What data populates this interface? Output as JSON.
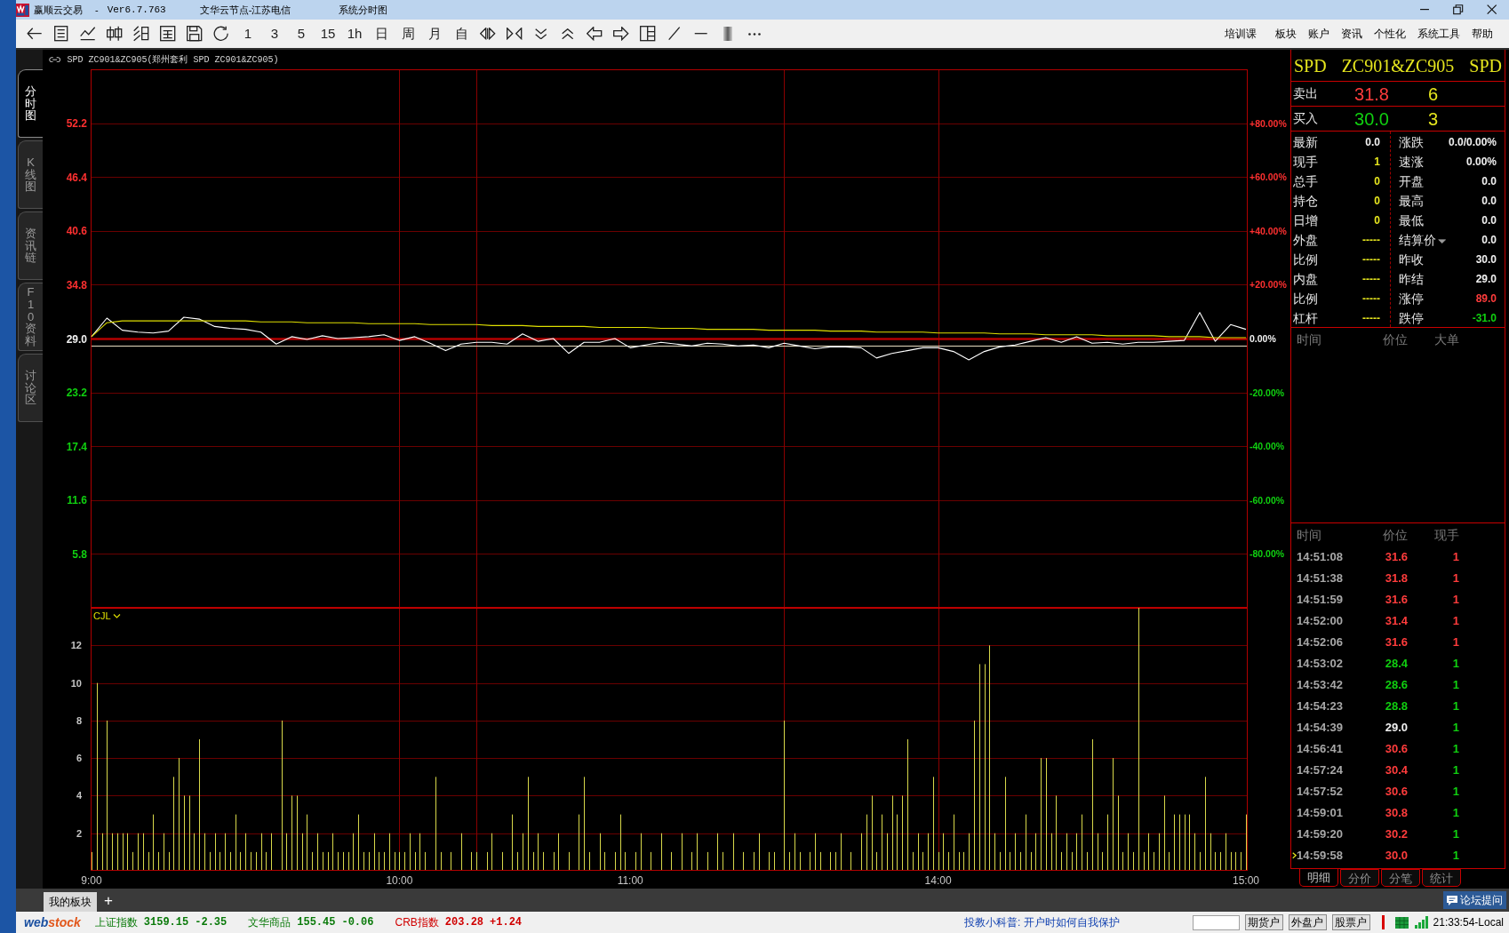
{
  "window": {
    "app_name": "赢顺云交易",
    "separator": "-",
    "version": "Ver6.7.763",
    "server": "文华云节点-江苏电信",
    "view": "系统分时图"
  },
  "toolbar": {
    "period_buttons": [
      "1",
      "3",
      "5",
      "15",
      "1h",
      "日",
      "周",
      "月",
      "自"
    ],
    "menu": [
      "培训课",
      "板块",
      "账户",
      "资讯",
      "个性化",
      "系统工具",
      "帮助"
    ]
  },
  "side_tabs": [
    {
      "label": "分时图",
      "selected": true
    },
    {
      "label": "K线图",
      "selected": false
    },
    {
      "label": "资讯链",
      "selected": false
    },
    {
      "label": "F10资料",
      "selected": false
    },
    {
      "label": "讨论区",
      "selected": false
    }
  ],
  "chart": {
    "header": "SPD ZC901&ZC905(郑州套利 SPD ZC901&ZC905)",
    "price_chart": {
      "percent_labels": [
        "+80.00%",
        "+60.00%",
        "+40.00%",
        "+20.00%",
        "0.00%",
        "-20.00%",
        "-40.00%",
        "-60.00%",
        "-80.00%"
      ],
      "chart_data": {
        "type": "line",
        "categories": [
          null,
          null,
          null,
          null,
          null,
          null,
          null,
          null,
          null,
          null,
          null,
          null,
          null,
          null,
          null,
          null,
          null,
          null,
          null,
          null,
          null,
          null,
          null,
          null,
          null,
          null,
          null,
          null,
          null,
          null,
          null,
          null,
          null,
          null,
          null,
          null,
          null,
          null,
          null,
          null,
          null,
          null,
          null,
          null,
          null,
          null,
          null,
          null,
          null,
          null,
          null,
          null,
          null,
          null,
          null,
          null,
          null,
          null,
          null,
          null,
          null,
          null,
          null,
          null,
          null,
          null,
          null,
          null,
          null,
          null,
          null,
          null,
          null,
          null,
          null,
          null
        ],
        "series": [
          {
            "color": "#ffffff",
            "values": [
              29.2,
              31.2,
              29.9,
              29.7,
              29.6,
              29.8,
              31.3,
              31.1,
              30.3,
              30.1,
              30.0,
              29.7,
              28.4,
              29.2,
              28.9,
              29.3,
              29.0,
              29.1,
              29.2,
              29.4,
              28.8,
              29.2,
              28.5,
              27.7,
              28.4,
              28.6,
              28.6,
              28.4,
              29.5,
              28.7,
              29.0,
              27.4,
              28.6,
              28.6,
              29.0,
              28.0,
              28.3,
              28.6,
              28.4,
              28.2,
              28.5,
              28.4,
              28.2,
              28.3,
              28.0,
              28.5,
              28.2,
              27.9,
              28.1,
              28.1,
              28.0,
              26.9,
              27.4,
              27.7,
              28.0,
              28.0,
              27.6,
              26.7,
              27.6,
              28.1,
              28.3,
              28.7,
              29.1,
              28.6,
              29.2,
              28.5,
              28.6,
              28.4,
              28.6,
              28.6,
              28.7,
              28.8,
              31.8,
              28.7,
              30.5,
              30.0
            ]
          },
          {
            "color": "#e0e000",
            "values": [
              29.2,
              30.7,
              30.9,
              30.9,
              30.9,
              30.9,
              30.9,
              30.9,
              30.9,
              30.9,
              30.9,
              30.8,
              30.8,
              30.8,
              30.7,
              30.7,
              30.7,
              30.7,
              30.6,
              30.6,
              30.6,
              30.6,
              30.5,
              30.5,
              30.5,
              30.5,
              30.4,
              30.4,
              30.4,
              30.3,
              30.3,
              30.3,
              30.3,
              30.2,
              30.2,
              30.2,
              30.2,
              30.1,
              30.1,
              30.1,
              30.0,
              30.0,
              30.0,
              30.0,
              29.9,
              29.9,
              29.9,
              29.9,
              29.8,
              29.8,
              29.8,
              29.7,
              29.7,
              29.7,
              29.7,
              29.6,
              29.6,
              29.6,
              29.6,
              29.5,
              29.5,
              29.5,
              29.4,
              29.4,
              29.4,
              29.4,
              29.3,
              29.3,
              29.3,
              29.3,
              29.2,
              29.2,
              29.2,
              29.1,
              29.1,
              29.1
            ]
          }
        ],
        "ylim": [
          0,
          58
        ],
        "yticks": [
          {
            "value": 52.2,
            "label": "52.2"
          },
          {
            "value": 46.4,
            "label": "46.4"
          },
          {
            "value": 40.6,
            "label": "40.6"
          },
          {
            "value": 34.8,
            "label": "34.8"
          },
          {
            "value": 29.0,
            "label": "29.0"
          },
          {
            "value": 23.2,
            "label": "23.2"
          },
          {
            "value": 17.4,
            "label": "17.4"
          },
          {
            "value": 11.6,
            "label": "11.6"
          },
          {
            "value": 5.8,
            "label": "5.8"
          }
        ],
        "grid": true,
        "ref_lines": [
          {
            "axis": "y",
            "value": 29.0
          },
          {
            "axis": "y",
            "value": 28.2
          }
        ]
      }
    },
    "volume_chart": {
      "chart_data": {
        "type": "bar",
        "title": "CJL",
        "categories": [
          "9:00",
          null,
          null,
          null,
          null,
          null,
          null,
          null,
          null,
          null,
          null,
          null,
          null,
          null,
          null,
          null,
          null,
          null,
          null,
          null,
          null,
          null,
          null,
          null,
          null,
          null,
          null,
          null,
          null,
          null,
          null,
          null,
          null,
          null,
          null,
          null,
          null,
          null,
          null,
          null,
          null,
          null,
          null,
          null,
          null,
          null,
          null,
          null,
          null,
          null,
          null,
          null,
          null,
          null,
          null,
          null,
          null,
          null,
          null,
          null,
          "10:00",
          null,
          null,
          null,
          null,
          null,
          null,
          null,
          null,
          null,
          null,
          null,
          null,
          null,
          null,
          null,
          null,
          null,
          null,
          null,
          null,
          null,
          null,
          null,
          null,
          null,
          null,
          null,
          null,
          null,
          null,
          null,
          null,
          null,
          null,
          null,
          null,
          null,
          null,
          null,
          null,
          null,
          null,
          null,
          null,
          "11:00",
          null,
          null,
          null,
          null,
          null,
          null,
          null,
          null,
          null,
          null,
          null,
          null,
          null,
          null,
          null,
          null,
          null,
          null,
          null,
          null,
          null,
          null,
          null,
          null,
          null,
          null,
          null,
          null,
          null,
          null,
          null,
          null,
          null,
          null,
          null,
          null,
          null,
          null,
          null,
          null,
          null,
          null,
          null,
          null,
          null,
          null,
          null,
          null,
          null,
          null,
          null,
          null,
          null,
          null,
          null,
          null,
          null,
          null,
          null,
          "14:00",
          null,
          null,
          null,
          null,
          null,
          null,
          null,
          null,
          null,
          null,
          null,
          null,
          null,
          null,
          null,
          null,
          null,
          null,
          null,
          null,
          null,
          null,
          null,
          null,
          null,
          null,
          null,
          null,
          null,
          null,
          null,
          null,
          null,
          null,
          null,
          null,
          null,
          null,
          null,
          null,
          null,
          null,
          null,
          null,
          null,
          null,
          null,
          null,
          null,
          null,
          null,
          null,
          null,
          null,
          null,
          null,
          null,
          null,
          null,
          "15:00"
        ],
        "values": [
          1,
          10,
          2,
          8,
          2,
          2,
          2,
          2,
          1,
          2,
          2,
          1,
          3,
          1,
          2,
          1,
          5,
          6,
          4,
          4,
          2,
          7,
          2,
          1,
          2,
          1,
          2,
          1,
          3,
          1,
          2,
          1,
          1,
          2,
          1,
          2,
          0,
          8,
          2,
          4,
          4,
          2,
          3,
          1,
          2,
          1,
          1,
          2,
          1,
          1,
          1,
          2,
          3,
          1,
          1,
          2,
          1,
          1,
          2,
          1,
          1,
          1,
          2,
          1,
          2,
          1,
          0,
          5,
          1,
          0,
          1,
          0,
          2,
          0,
          1,
          1,
          0,
          1,
          2,
          0,
          1,
          0,
          3,
          1,
          2,
          5,
          1,
          2,
          1,
          0,
          1,
          2,
          0,
          1,
          0,
          3,
          5,
          1,
          0,
          2,
          1,
          0,
          1,
          3,
          1,
          0,
          1,
          2,
          0,
          1,
          0,
          2,
          0,
          1,
          0,
          2,
          0,
          1,
          2,
          0,
          1,
          0,
          2,
          1,
          0,
          2,
          0,
          1,
          0,
          1,
          2,
          0,
          1,
          1,
          0,
          8,
          1,
          2,
          1,
          0,
          1,
          2,
          1,
          0,
          1,
          1,
          2,
          0,
          1,
          0,
          2,
          3,
          4,
          1,
          3,
          2,
          4,
          3,
          4,
          7,
          1,
          2,
          1,
          2,
          5,
          1,
          2,
          1,
          3,
          1,
          1,
          2,
          8,
          11,
          11,
          12,
          2,
          1,
          5,
          1,
          2,
          1,
          3,
          1,
          2,
          6,
          6,
          2,
          4,
          1,
          2,
          1,
          2,
          3,
          1,
          7,
          2,
          1,
          3,
          6,
          4,
          1,
          2,
          1,
          14,
          1,
          2,
          1,
          2,
          4,
          1,
          3,
          3,
          3,
          3,
          2,
          1,
          5,
          2,
          1,
          1,
          2,
          1,
          1,
          1,
          3
        ],
        "ylim": [
          0,
          14
        ],
        "yticks": [
          2,
          4,
          6,
          8,
          10,
          12
        ],
        "grid": true
      }
    }
  },
  "quote_panel": {
    "title": [
      "SPD",
      "ZC901&ZC905",
      "SPD"
    ],
    "order_book": [
      {
        "label": "卖出",
        "price": {
          "text": "31.8",
          "color": "#ff3c3c"
        },
        "volume": "6"
      },
      {
        "label": "买入",
        "price": {
          "text": "30.0",
          "color": "#10d010"
        },
        "volume": "3"
      }
    ],
    "stats": {
      "left": [
        {
          "label": "最新",
          "value": "0.0",
          "color": "#f0f0f0"
        },
        {
          "label": "现手",
          "value": "1",
          "color": "#e6e61e"
        },
        {
          "label": "总手",
          "value": "0",
          "color": "#e6e61e"
        },
        {
          "label": "持仓",
          "value": "0",
          "color": "#e6e61e"
        },
        {
          "label": "日增",
          "value": "0",
          "color": "#e6e61e"
        },
        {
          "label": "外盘",
          "value": "-----",
          "color": "#e6e61e"
        },
        {
          "label": "比例",
          "value": "-----",
          "color": "#e6e61e"
        },
        {
          "label": "内盘",
          "value": "-----",
          "color": "#e6e61e"
        },
        {
          "label": "比例",
          "value": "-----",
          "color": "#e6e61e"
        },
        {
          "label": "杠杆",
          "value": "-----",
          "color": "#e6e61e"
        }
      ],
      "right": [
        {
          "kind": "plain",
          "label": "涨跌",
          "value": "0.0/0.00%",
          "color": "#f0f0f0"
        },
        {
          "kind": "plain",
          "label": "速涨",
          "value": "0.00%",
          "color": "#f0f0f0"
        },
        {
          "kind": "plain",
          "label": "开盘",
          "value": "0.0",
          "color": "#f0f0f0"
        },
        {
          "kind": "plain",
          "label": "最高",
          "value": "0.0",
          "color": "#f0f0f0"
        },
        {
          "kind": "plain",
          "label": "最低",
          "value": "0.0",
          "color": "#f0f0f0"
        },
        {
          "kind": "dropdown",
          "label": "结算价",
          "value": "0.0",
          "color": "#f0f0f0"
        },
        {
          "kind": "plain",
          "label": "昨收",
          "value": "30.0",
          "color": "#f0f0f0"
        },
        {
          "kind": "plain",
          "label": "昨结",
          "value": "29.0",
          "color": "#f0f0f0"
        },
        {
          "kind": "plain",
          "label": "涨停",
          "value": "89.0",
          "color": "#ff3c3c"
        },
        {
          "kind": "plain",
          "label": "跌停",
          "value": "-31.0",
          "color": "#10d010"
        }
      ]
    },
    "big_orders": {
      "columns": [
        "时间",
        "价位",
        "大单"
      ]
    },
    "trades": {
      "columns": [
        "时间",
        "价位",
        "现手"
      ],
      "rows": [
        {
          "time": "14:51:08",
          "price": {
            "text": "31.6",
            "color": "#ff3c3c"
          },
          "volume": {
            "text": "1",
            "color": "#ff3c3c"
          },
          "current": false
        },
        {
          "time": "14:51:38",
          "price": {
            "text": "31.8",
            "color": "#ff3c3c"
          },
          "volume": {
            "text": "1",
            "color": "#ff3c3c"
          },
          "current": false
        },
        {
          "time": "14:51:59",
          "price": {
            "text": "31.6",
            "color": "#ff3c3c"
          },
          "volume": {
            "text": "1",
            "color": "#ff3c3c"
          },
          "current": false
        },
        {
          "time": "14:52:00",
          "price": {
            "text": "31.4",
            "color": "#ff3c3c"
          },
          "volume": {
            "text": "1",
            "color": "#ff3c3c"
          },
          "current": false
        },
        {
          "time": "14:52:06",
          "price": {
            "text": "31.6",
            "color": "#ff3c3c"
          },
          "volume": {
            "text": "1",
            "color": "#ff3c3c"
          },
          "current": false
        },
        {
          "time": "14:53:02",
          "price": {
            "text": "28.4",
            "color": "#10d010"
          },
          "volume": {
            "text": "1",
            "color": "#10d010"
          },
          "current": false
        },
        {
          "time": "14:53:42",
          "price": {
            "text": "28.6",
            "color": "#10d010"
          },
          "volume": {
            "text": "1",
            "color": "#10d010"
          },
          "current": false
        },
        {
          "time": "14:54:23",
          "price": {
            "text": "28.8",
            "color": "#10d010"
          },
          "volume": {
            "text": "1",
            "color": "#10d010"
          },
          "current": false
        },
        {
          "time": "14:54:39",
          "price": {
            "text": "29.0",
            "color": "#f0f0f0"
          },
          "volume": {
            "text": "1",
            "color": "#10d010"
          },
          "current": false
        },
        {
          "time": "14:56:41",
          "price": {
            "text": "30.6",
            "color": "#ff3c3c"
          },
          "volume": {
            "text": "1",
            "color": "#10d010"
          },
          "current": false
        },
        {
          "time": "14:57:24",
          "price": {
            "text": "30.4",
            "color": "#ff3c3c"
          },
          "volume": {
            "text": "1",
            "color": "#10d010"
          },
          "current": false
        },
        {
          "time": "14:57:52",
          "price": {
            "text": "30.6",
            "color": "#ff3c3c"
          },
          "volume": {
            "text": "1",
            "color": "#10d010"
          },
          "current": false
        },
        {
          "time": "14:59:01",
          "price": {
            "text": "30.8",
            "color": "#ff3c3c"
          },
          "volume": {
            "text": "1",
            "color": "#10d010"
          },
          "current": false
        },
        {
          "time": "14:59:20",
          "price": {
            "text": "30.2",
            "color": "#ff3c3c"
          },
          "volume": {
            "text": "1",
            "color": "#10d010"
          },
          "current": false
        },
        {
          "time": "14:59:58",
          "price": {
            "text": "30.0",
            "color": "#ff3c3c"
          },
          "volume": {
            "text": "1",
            "color": "#10d010"
          },
          "current": true
        }
      ]
    },
    "tabs": [
      {
        "label": "明细",
        "selected": true
      },
      {
        "label": "分价",
        "selected": false
      },
      {
        "label": "分笔",
        "selected": false
      },
      {
        "label": "统计",
        "selected": false
      }
    ]
  },
  "bottom_bar": {
    "sheet_tabs": [
      {
        "label": "我的板块",
        "selected": true
      }
    ],
    "add_tab": "+",
    "forum_button": "论坛提问"
  },
  "status_bar": {
    "logo": [
      "web",
      "stock"
    ],
    "indices": [
      {
        "label": "上证指数",
        "value": "3159.15",
        "change": "-2.35",
        "color": "#0a7a0a"
      },
      {
        "label": "文华商品",
        "value": "155.45",
        "change": "-0.06",
        "color": "#0a7a0a"
      },
      {
        "label": "CRB指数",
        "value": "203.28",
        "change": "+1.24",
        "color": "#d00000"
      }
    ],
    "news": "投教小科普: 开户时如何自我保护",
    "account_buttons": [
      "期货户",
      "外盘户",
      "股票户"
    ],
    "clock": "21:33:54-Local"
  }
}
